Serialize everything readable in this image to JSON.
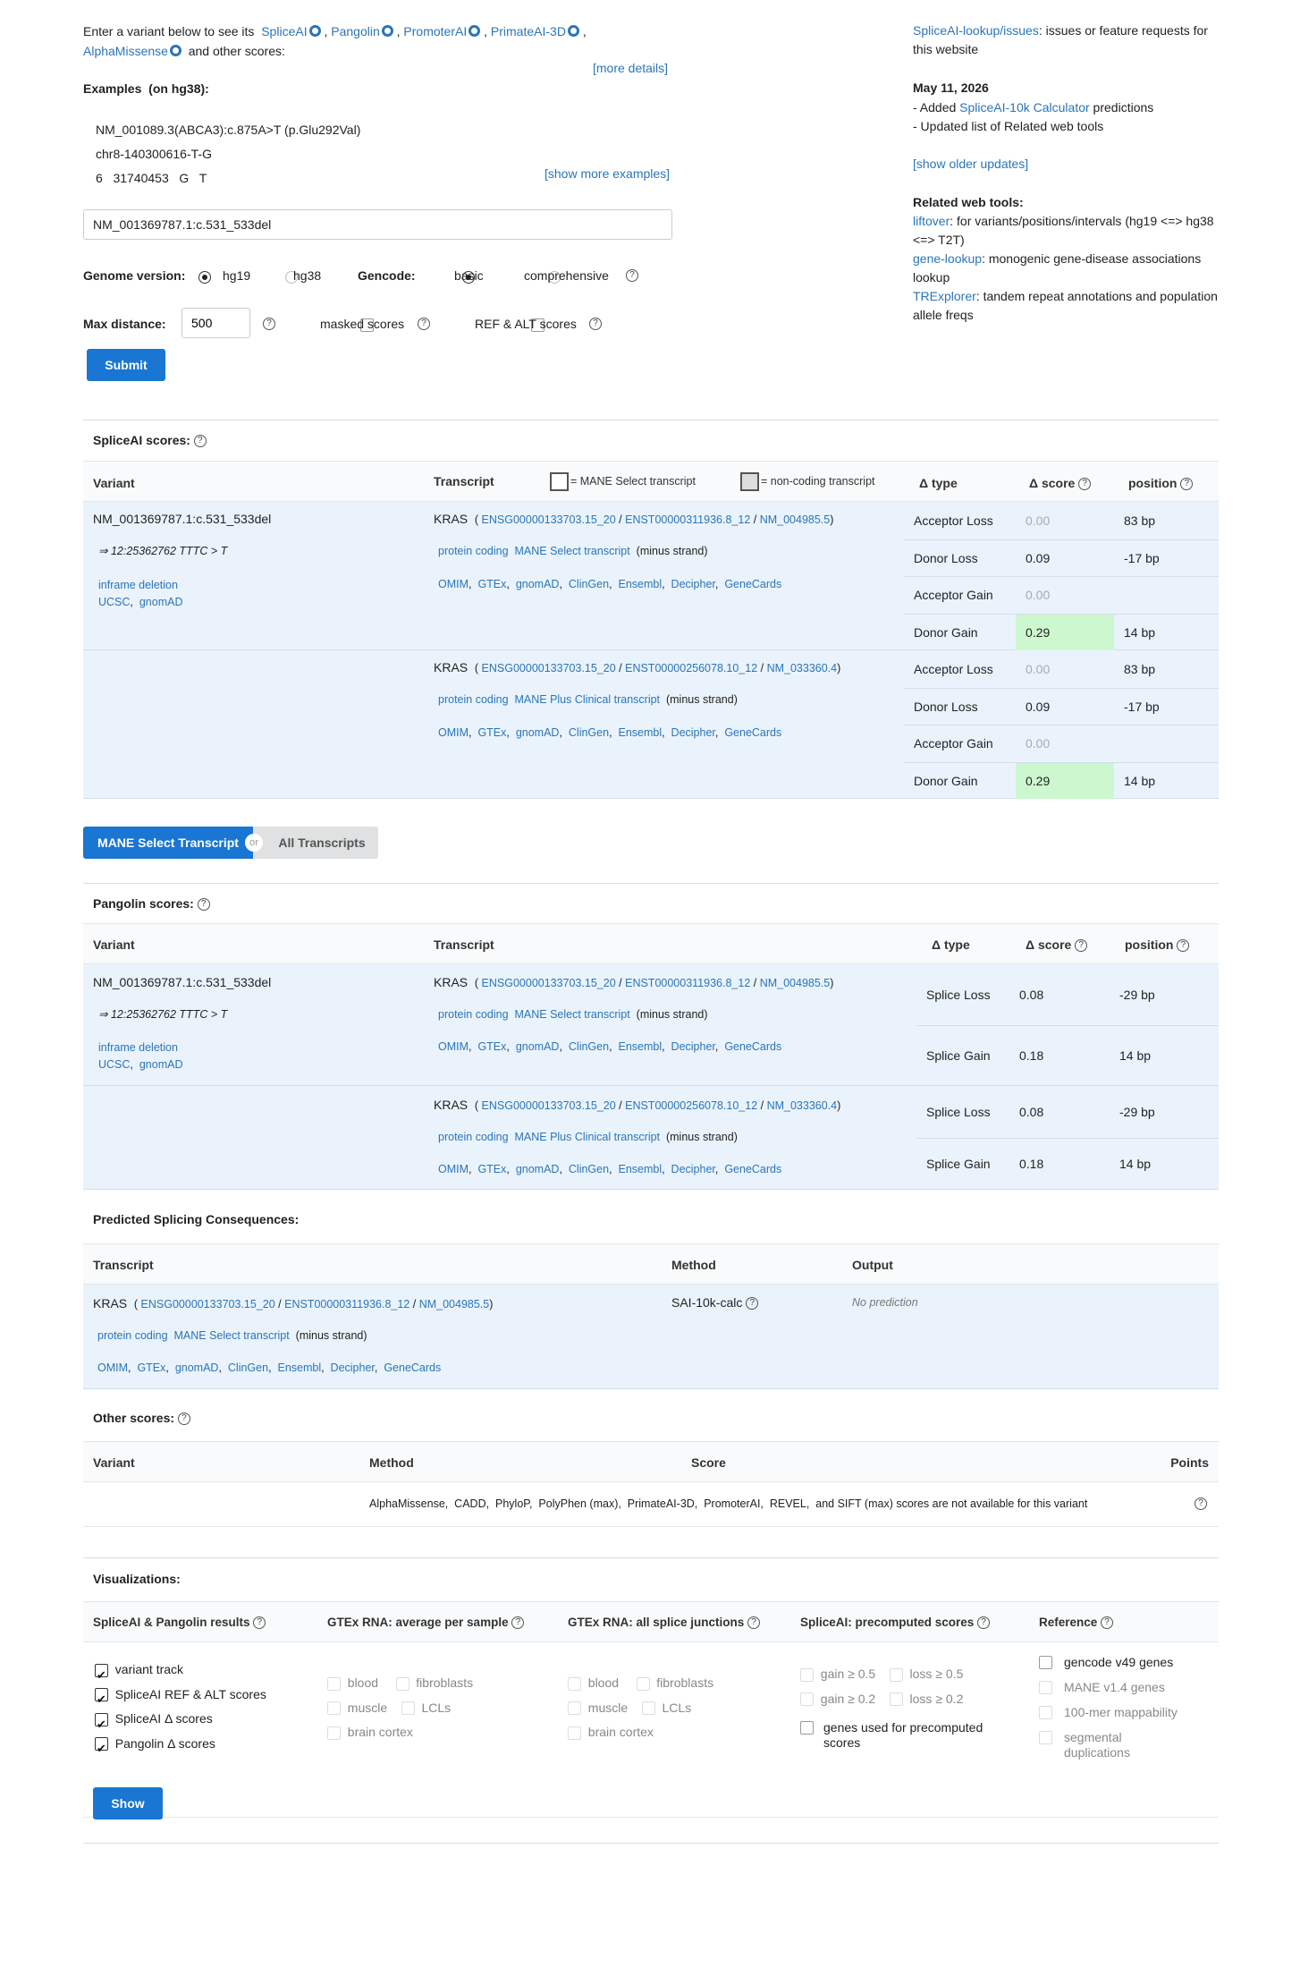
{
  "intro": {
    "text1": "Enter a variant below to see its",
    "tools": [
      "SpliceAI",
      "Pangolin",
      "PromoterAI",
      "PrimateAI-3D",
      "AlphaMissense"
    ],
    "text2": "and other scores:",
    "more_details": "[more details]",
    "examples_label": "Examples",
    "examples_build": "(on hg38):",
    "examples": [
      "NM_001089.3(ABCA3):c.875A>T (p.Glu292Val)",
      "chr8-140300616-T-G",
      "6   31740453   G   T"
    ],
    "show_more": "[show more examples]",
    "input_value": "NM_001369787.1:c.531_533del"
  },
  "form": {
    "genome_label": "Genome version:",
    "genome_options": [
      "hg19",
      "hg38"
    ],
    "gencode_label": "Gencode:",
    "gencode_options": [
      "basic",
      "comprehensive"
    ],
    "maxdist_label": "Max distance:",
    "maxdist_value": "500",
    "masked_label": "masked scores",
    "refalt_label": "REF & ALT scores",
    "submit": "Submit"
  },
  "right": {
    "issues_link": "SpliceAI-lookup/issues",
    "issues_text": ": issues or feature requests for this website",
    "date": "May 11, 2026",
    "upd1_pre": "- Added ",
    "upd1_link": "SpliceAI-10k Calculator",
    "upd1_post": " predictions",
    "upd2": "- Updated list of Related web tools",
    "older": "[show older updates]",
    "related_title": "Related web tools:",
    "tools": [
      {
        "name": "liftover",
        "desc": ": for variants/positions/intervals (hg19 <=> hg38 <=> T2T)"
      },
      {
        "name": "gene-lookup",
        "desc": ": monogenic gene-disease associations lookup"
      },
      {
        "name": "TRExplorer",
        "desc": ": tandem repeat annotations and population allele freqs"
      }
    ]
  },
  "variant": {
    "name": "NM_001369787.1:c.531_533del",
    "coord": "⇒ 12:25362762 TTTC > T",
    "consequence": "inframe deletion",
    "links": [
      "UCSC",
      "gnomAD"
    ]
  },
  "transcripts": [
    {
      "gene": "KRAS",
      "gene_id": "ENSG00000133703.15_20",
      "tx_id": "ENST00000311936.8_12",
      "refseq": "NM_004985.5",
      "biotype": "protein coding",
      "tag": "MANE Select transcript",
      "strand": "(minus strand)"
    },
    {
      "gene": "KRAS",
      "gene_id": "ENSG00000133703.15_20",
      "tx_id": "ENST00000256078.10_12",
      "refseq": "NM_033360.4",
      "biotype": "protein coding",
      "tag": "MANE Plus Clinical transcript",
      "strand": "(minus strand)"
    }
  ],
  "ext_links": [
    "OMIM",
    "GTEx",
    "gnomAD",
    "ClinGen",
    "Ensembl",
    "Decipher",
    "GeneCards"
  ],
  "spliceai": {
    "title": "SpliceAI scores:",
    "headers": {
      "variant": "Variant",
      "transcript": "Transcript",
      "mane_legend": "= MANE Select transcript",
      "noncoding_legend": "= non-coding transcript",
      "type": "Δ type",
      "score": "Δ score",
      "position": "position"
    },
    "rows": [
      [
        {
          "type": "Acceptor Loss",
          "score": "0.00",
          "pos": "83 bp"
        },
        {
          "type": "Donor Loss",
          "score": "0.09",
          "pos": "-17 bp"
        },
        {
          "type": "Acceptor Gain",
          "score": "0.00",
          "pos": ""
        },
        {
          "type": "Donor Gain",
          "score": "0.29",
          "pos": "14 bp"
        }
      ],
      [
        {
          "type": "Acceptor Loss",
          "score": "0.00",
          "pos": "83 bp"
        },
        {
          "type": "Donor Loss",
          "score": "0.09",
          "pos": "-17 bp"
        },
        {
          "type": "Acceptor Gain",
          "score": "0.00",
          "pos": ""
        },
        {
          "type": "Donor Gain",
          "score": "0.29",
          "pos": "14 bp"
        }
      ]
    ]
  },
  "toggle": {
    "mane": "MANE Select Transcript",
    "or": "or",
    "all": "All Transcripts"
  },
  "pangolin": {
    "title": "Pangolin scores:",
    "headers": {
      "variant": "Variant",
      "transcript": "Transcript",
      "type": "Δ type",
      "score": "Δ score",
      "position": "position"
    },
    "rows": [
      [
        {
          "type": "Splice Loss",
          "score": "0.08",
          "pos": "-29 bp"
        },
        {
          "type": "Splice Gain",
          "score": "0.18",
          "pos": "14 bp"
        }
      ],
      [
        {
          "type": "Splice Loss",
          "score": "0.08",
          "pos": "-29 bp"
        },
        {
          "type": "Splice Gain",
          "score": "0.18",
          "pos": "14 bp"
        }
      ]
    ]
  },
  "consequences": {
    "title": "Predicted Splicing Consequences:",
    "headers": {
      "transcript": "Transcript",
      "method": "Method",
      "output": "Output"
    },
    "method": "SAI-10k-calc",
    "output": "No prediction"
  },
  "other": {
    "title": "Other scores:",
    "headers": {
      "variant": "Variant",
      "method": "Method",
      "score": "Score",
      "points": "Points"
    },
    "message": "AlphaMissense,  CADD,  PhyloP,  PolyPhen (max),  PrimateAI-3D,  PromoterAI,  REVEL,  and SIFT (max) scores are not available for this variant"
  },
  "viz": {
    "title": "Visualizations:",
    "col_headers": [
      "SpliceAI & Pangolin results",
      "GTEx RNA: average per sample",
      "GTEx RNA: all splice junctions",
      "SpliceAI: precomputed scores",
      "Reference"
    ],
    "results": [
      "variant track",
      "SpliceAI REF & ALT scores",
      "SpliceAI Δ  scores",
      "Pangolin Δ  scores"
    ],
    "gtex": [
      "blood",
      "fibroblasts",
      "muscle",
      "LCLs",
      "brain cortex"
    ],
    "precomputed": [
      "gain ≥ 0.5",
      "loss ≥ 0.5",
      "gain ≥ 0.2",
      "loss ≥ 0.2",
      "genes used for precomputed scores"
    ],
    "reference": [
      "gencode v49 genes",
      "MANE v1.4 genes",
      "100-mer mappability",
      "segmental duplications"
    ],
    "show": "Show"
  }
}
